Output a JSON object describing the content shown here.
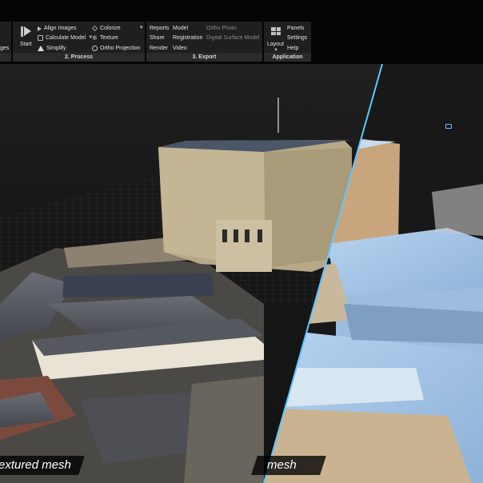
{
  "ribbon": {
    "clipped_left_label": "ges",
    "start_label": "Start",
    "process": {
      "align_images": "Align Images",
      "calculate_model": "Calculate Model",
      "simplify": "Simplify",
      "colorize": "Colorize",
      "texture": "Texture",
      "ortho_projection": "Ortho Projection",
      "group_label": "2. Process"
    },
    "export": {
      "reports": "Reports",
      "share": "Share",
      "render": "Render",
      "model": "Model",
      "registration": "Registration",
      "video": "Video",
      "ortho_photo": "Ortho Photo",
      "digital_surface_model": "Digital Surface Model",
      "group_label": "3. Export"
    },
    "application": {
      "layout": "Layout",
      "panels": "Panels",
      "settings": "Settings",
      "help": "Help",
      "group_label": "Application"
    }
  },
  "viewport": {
    "left_caption": "extured mesh",
    "right_caption": "mesh",
    "colors": {
      "split_line": "#5fc8ff",
      "mesh_tint": "#9ec3e6",
      "stone": "#b9aa8a",
      "roof": "#5c5f66"
    }
  }
}
